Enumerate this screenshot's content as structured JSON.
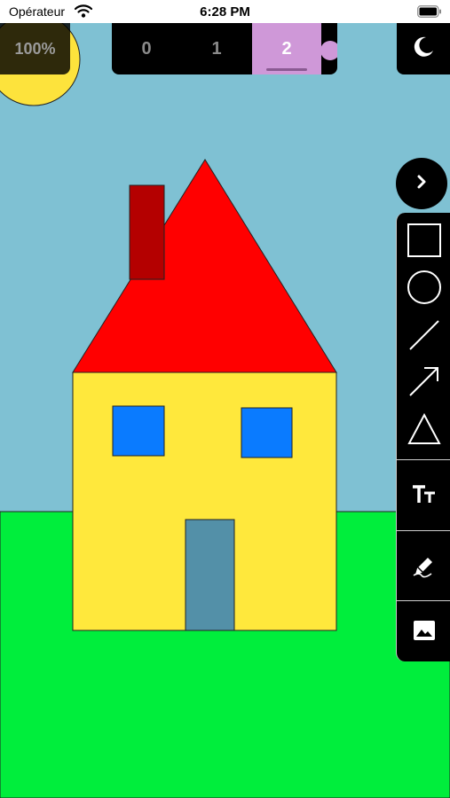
{
  "status_bar": {
    "carrier": "Opérateur",
    "time": "6:28 PM"
  },
  "zoom": {
    "label": "100%"
  },
  "layers": {
    "tabs": [
      {
        "label": "0"
      },
      {
        "label": "1"
      },
      {
        "label": "2"
      }
    ],
    "active_index": 2
  },
  "toolbar": {
    "tools": [
      "square-icon",
      "circle-icon",
      "line-icon",
      "arrow-icon",
      "triangle-icon",
      "text-icon",
      "pencil-icon",
      "image-icon"
    ]
  },
  "colors": {
    "sky": "#7fc1d3",
    "sun": "#fde33c",
    "grass": "#00ee3c",
    "roof": "#ff0000",
    "chimney": "#b40000",
    "wall": "#ffe83c",
    "window": "#0a7bff",
    "door": "#5390a8",
    "active_layer": "#cf98d8"
  }
}
